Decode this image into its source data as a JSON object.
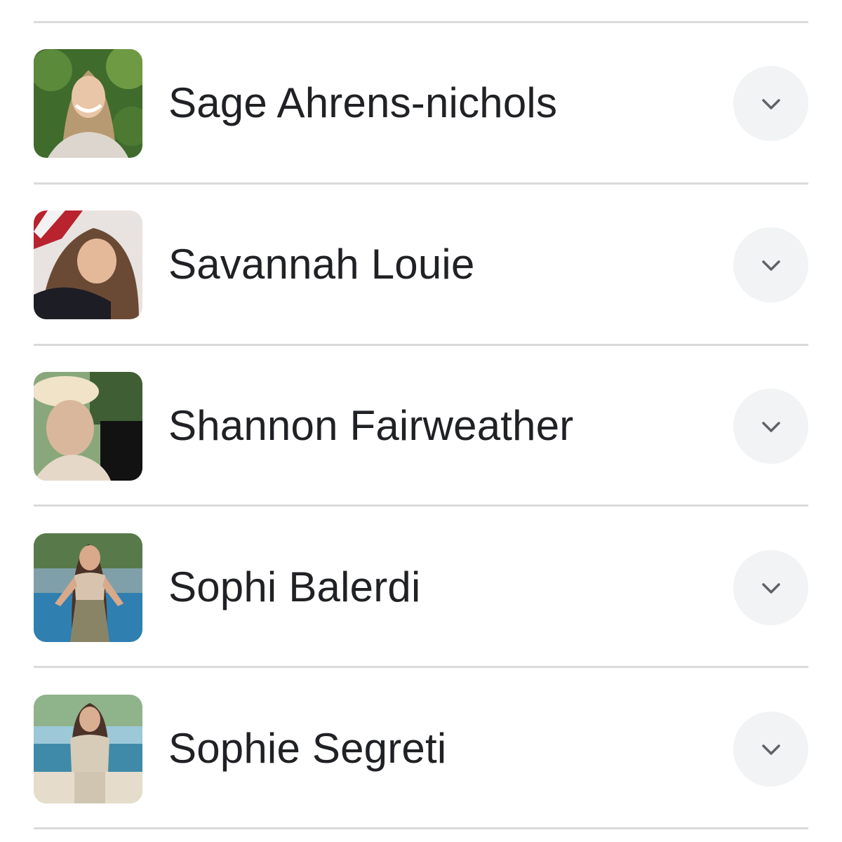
{
  "people": [
    {
      "name": "Sage Ahrens-nichols",
      "avatar_icon": "person-photo",
      "expand_icon": "chevron-down-icon"
    },
    {
      "name": "Savannah Louie",
      "avatar_icon": "person-photo",
      "expand_icon": "chevron-down-icon"
    },
    {
      "name": "Shannon Fairweather",
      "avatar_icon": "person-photo",
      "expand_icon": "chevron-down-icon"
    },
    {
      "name": "Sophi Balerdi",
      "avatar_icon": "person-photo",
      "expand_icon": "chevron-down-icon"
    },
    {
      "name": "Sophie Segreti",
      "avatar_icon": "person-photo",
      "expand_icon": "chevron-down-icon"
    }
  ],
  "colors": {
    "divider": "#dadada",
    "name_text": "#202124",
    "expand_button_bg": "#f1f3f4",
    "chevron": "#5f6368"
  }
}
